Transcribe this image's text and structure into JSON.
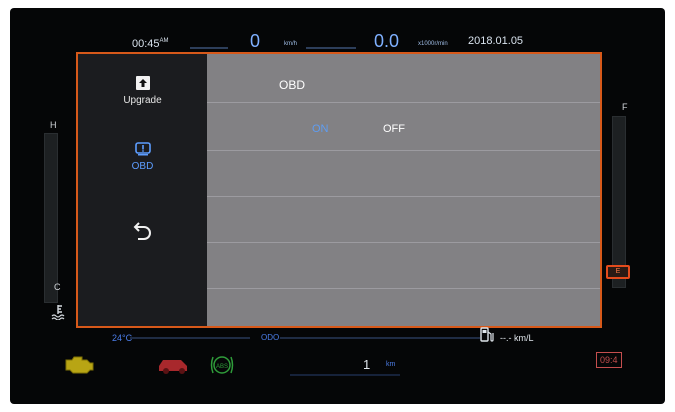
{
  "status": {
    "time": "00:45",
    "ampm": "AM",
    "speed": "0",
    "speed_unit": "km/h",
    "rpm": "0.0",
    "rpm_unit": "x1000r/min",
    "date": "2018.01.05"
  },
  "sidebar": {
    "items": [
      {
        "label": "Upgrade",
        "icon": "upload-icon"
      },
      {
        "label": "OBD",
        "icon": "warning-icon",
        "active": true
      },
      {
        "label": "",
        "icon": "back-arrow-icon"
      }
    ]
  },
  "main": {
    "title": "OBD",
    "options": {
      "on": "ON",
      "off": "OFF",
      "selected": "ON"
    }
  },
  "gauges": {
    "temp_high": "H",
    "temp_low": "C",
    "fuel_full": "F",
    "fuel_empty": "E"
  },
  "bottom": {
    "temperature": "24°C",
    "odo_label": "ODO",
    "fuel_economy": "--.- km/L",
    "trip_value": "1",
    "trip_unit": "km",
    "small_clock": "09:4"
  },
  "colors": {
    "accent_blue": "#5d9dff",
    "border_orange": "#d7591a",
    "panel_gray": "#828184",
    "sidebar_dark": "#1b1c1f"
  }
}
